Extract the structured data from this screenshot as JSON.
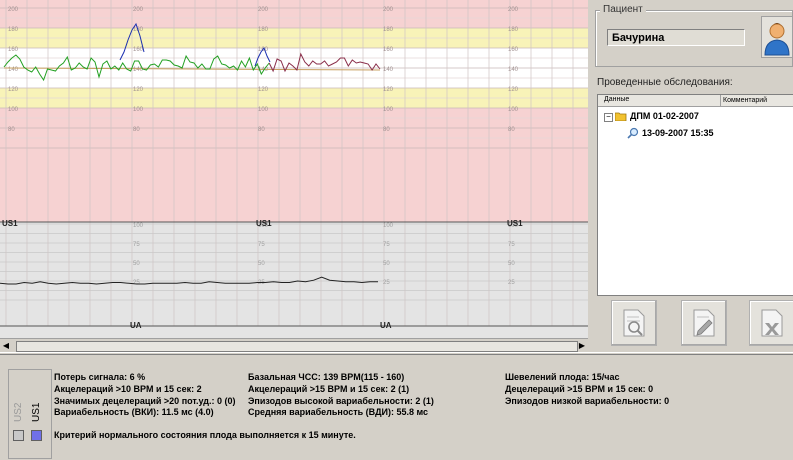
{
  "chart": {
    "fhr_ticks": [
      "200",
      "180",
      "160",
      "140",
      "120",
      "100",
      "80"
    ],
    "uc_ticks": [
      "100",
      "75",
      "50",
      "25"
    ],
    "channel_label_fhr": "US1",
    "channel_label_uc": "UA",
    "tick_columns": [
      1,
      2,
      3
    ],
    "fhr_trace": [
      141,
      146,
      150,
      153,
      149,
      141,
      138,
      136,
      141,
      134,
      128,
      139,
      138,
      137,
      142,
      145,
      151,
      138,
      140,
      145,
      141,
      139,
      150,
      146,
      131,
      144,
      147,
      139,
      142,
      138,
      145,
      139,
      137,
      147,
      147,
      139,
      138,
      143,
      144,
      141,
      148,
      148,
      147,
      143,
      142,
      140,
      152,
      146,
      145,
      140,
      144,
      139,
      139,
      149,
      152,
      144,
      143,
      140,
      142,
      138,
      147,
      141,
      150,
      138,
      144,
      134,
      140,
      145,
      137,
      149,
      147,
      137,
      145,
      142,
      138,
      154,
      146,
      142,
      147,
      144,
      144,
      147,
      142,
      144,
      146,
      150,
      150,
      142,
      148,
      145,
      146,
      145,
      144,
      138,
      144,
      139
    ],
    "fhr_accel1": [
      148,
      156,
      168,
      178,
      184,
      172,
      156
    ],
    "fhr_accel2": [
      142,
      150,
      156,
      160,
      152,
      146
    ],
    "baseline": 139,
    "uc_trace": [
      22,
      21,
      21,
      23,
      22,
      24,
      22,
      21,
      22,
      23,
      22,
      22,
      21,
      22,
      23,
      23,
      22,
      21,
      21,
      22,
      22,
      22,
      22,
      23,
      22,
      22,
      24,
      23,
      22,
      22,
      22,
      22,
      23,
      23,
      24,
      23,
      23,
      25,
      24,
      26,
      30,
      26,
      25,
      24,
      24,
      23,
      24,
      24
    ]
  },
  "patient": {
    "group_label": "Пациент",
    "name": "Бачурина",
    "exams_label": "Проведенные обследования:",
    "columns": [
      "Данные",
      "Комментарий"
    ],
    "tree": {
      "expander": "−",
      "folder": "ДПМ 01-02-2007",
      "item": "13-09-2007 15:35"
    }
  },
  "icons": {
    "avatar": "person-icon",
    "tool1": "document-search-icon",
    "tool2": "document-edit-icon",
    "tool3": "document-delete-icon"
  },
  "colors": {
    "fhr_trace": "#22a022",
    "fhr_accel": "#1a2fb0",
    "fhr_late": "#8a2e4a",
    "baseline": "#c8a060",
    "uc_trace": "#222222",
    "red_zone": "#f6d2d2",
    "yellow_zone": "#f8f3b8",
    "uc_bg": "#e4e4e4"
  },
  "legend": {
    "off_label": "US2",
    "on_label": "US1"
  },
  "stats": {
    "signal_loss": "Потерь сигнала: 6 %",
    "accel_10": "Акцелераций >10 BPM и 15 сек: 2",
    "decel_20": "Значимых децелераций >20 пот.уд.: 0 (0)",
    "variability_vki": "Вариабельность (ВКИ): 11.5 мс (4.0)",
    "basal_hr": "Базальная ЧСС: 139 BPM(115 - 160)",
    "accel_15": "Акцелераций >15 BPM и 15 сек: 2 (1)",
    "high_var": "Эпизодов высокой вариабельности: 2 (1)",
    "avg_var": "Средняя вариабельность (ВДИ): 55.8 мс",
    "movements": "Шевелений плода: 15/час",
    "decel_15": "Децелераций >15 BPM и 15 сек: 0",
    "low_var": "Эпизодов низкой вариабельности: 0",
    "criterion": "Критерий нормального состояния плода выполняется к 15 минуте."
  }
}
